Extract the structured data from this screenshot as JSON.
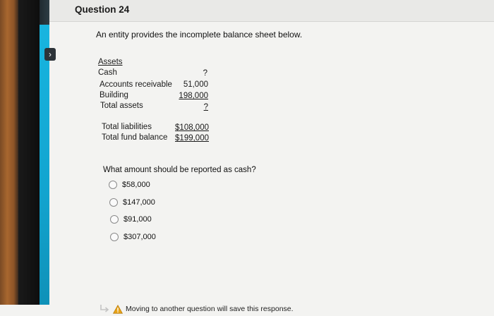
{
  "header": {
    "title": "Question 24"
  },
  "prompt": "An entity provides the incomplete balance sheet below.",
  "balance_sheet": {
    "assets_heading": "Assets",
    "rows": [
      {
        "label": "Cash",
        "value": "?"
      },
      {
        "label": "Accounts receivable",
        "value": "51,000"
      },
      {
        "label": "Building",
        "value": "198,000"
      },
      {
        "label": "Total assets",
        "value": "?"
      }
    ],
    "totals": [
      {
        "label": "Total liabilities",
        "value": "$108,000"
      },
      {
        "label": "Total fund balance",
        "value": "$199,000"
      }
    ]
  },
  "question": "What amount should be reported as cash?",
  "options": [
    {
      "label": "$58,000"
    },
    {
      "label": "$147,000"
    },
    {
      "label": "$91,000"
    },
    {
      "label": "$307,000"
    }
  ],
  "footer": {
    "notice": "Moving to another question will save this response."
  },
  "colors": {
    "accent": "#12a4cf",
    "warning": "#e8a317"
  }
}
